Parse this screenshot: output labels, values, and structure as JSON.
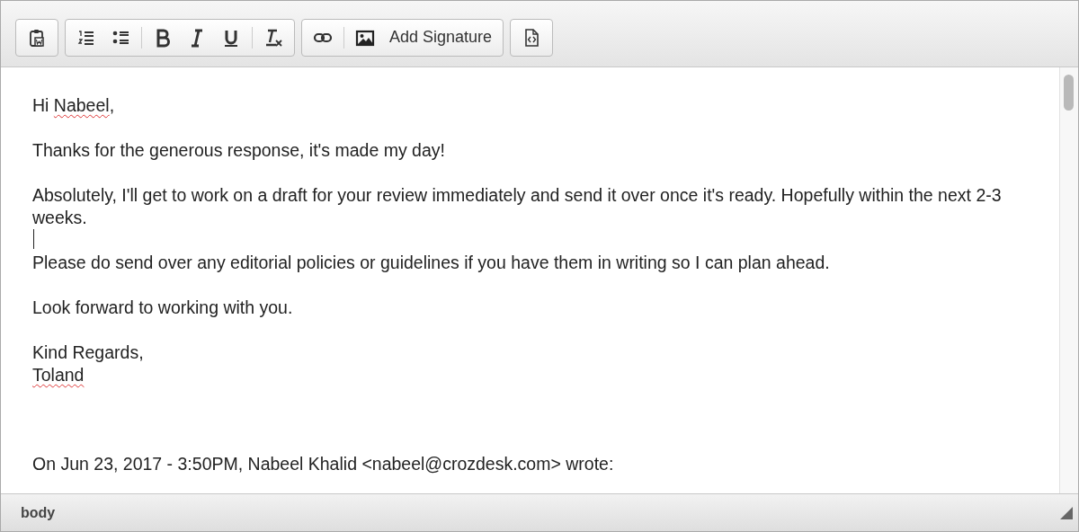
{
  "toolbar": {
    "groups": [
      [
        {
          "kind": "paste"
        }
      ],
      [
        {
          "kind": "numbered"
        },
        {
          "kind": "bulleted"
        },
        {
          "kind": "separator"
        },
        {
          "kind": "bold"
        },
        {
          "kind": "italic"
        },
        {
          "kind": "underline"
        },
        {
          "kind": "separator"
        },
        {
          "kind": "clear"
        }
      ],
      [
        {
          "kind": "link"
        },
        {
          "kind": "separator"
        },
        {
          "kind": "image"
        },
        {
          "kind": "text",
          "label": "Add Signature"
        }
      ],
      [
        {
          "kind": "source"
        }
      ]
    ]
  },
  "body": {
    "paragraphs": [
      {
        "kind": "text",
        "lines": [
          [
            {
              "text": "Hi "
            },
            {
              "text": "Nabeel",
              "misspelled": true
            },
            {
              "text": ","
            }
          ]
        ]
      },
      {
        "kind": "text",
        "lines": [
          [
            {
              "text": "Thanks for the generous response, it's made my day!"
            }
          ]
        ]
      },
      {
        "kind": "text",
        "lines": [
          [
            {
              "text": "Absolutely, I'll get to work on a draft for your review immediately and send it over once it's ready. Hopefully within the next 2-3 weeks."
            }
          ]
        ]
      },
      {
        "kind": "caret"
      },
      {
        "kind": "text",
        "lines": [
          [
            {
              "text": "Please do send over any editorial policies or guidelines if you have them in writing so I can plan ahead."
            }
          ]
        ]
      },
      {
        "kind": "text",
        "lines": [
          [
            {
              "text": "Look forward to working with you."
            }
          ]
        ]
      },
      {
        "kind": "text",
        "lines": [
          [
            {
              "text": "Kind Regards,"
            }
          ],
          [
            {
              "text": "Toland",
              "misspelled": true
            }
          ]
        ]
      },
      {
        "kind": "attribution",
        "lines": [
          [
            {
              "text": "On Jun 23, 2017 - 3:50PM, Nabeel Khalid <nabeel@crozdesk.com> wrote:"
            }
          ]
        ]
      }
    ]
  },
  "status_bar": {
    "path": "body"
  }
}
